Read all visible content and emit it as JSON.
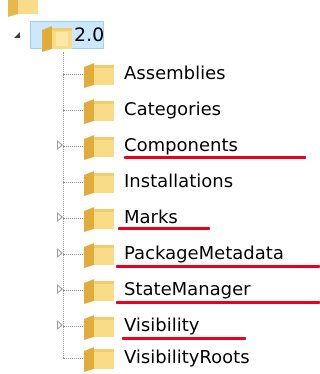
{
  "colors": {
    "selection_fill": "#cce8ff",
    "selection_border": "#99d1ff",
    "annotation_underline": "#e8001c",
    "folder_light": "#f8dc88",
    "folder_dark": "#d9a73c"
  },
  "tree": {
    "root": {
      "label": "2.0",
      "expanded": true,
      "selected": true,
      "icon": "folder-icon"
    },
    "children": [
      {
        "label": "Assemblies",
        "expandable": false,
        "underlined": false,
        "icon": "folder-icon"
      },
      {
        "label": "Categories",
        "expandable": false,
        "underlined": false,
        "icon": "folder-icon"
      },
      {
        "label": "Components",
        "expandable": true,
        "underlined": true,
        "icon": "folder-icon"
      },
      {
        "label": "Installations",
        "expandable": false,
        "underlined": false,
        "icon": "folder-icon"
      },
      {
        "label": "Marks",
        "expandable": true,
        "underlined": true,
        "icon": "folder-icon"
      },
      {
        "label": "PackageMetadata",
        "expandable": true,
        "underlined": true,
        "icon": "folder-icon"
      },
      {
        "label": "StateManager",
        "expandable": true,
        "underlined": true,
        "icon": "folder-icon"
      },
      {
        "label": "Visibility",
        "expandable": true,
        "underlined": true,
        "icon": "folder-icon"
      },
      {
        "label": "VisibilityRoots",
        "expandable": false,
        "underlined": false,
        "icon": "folder-icon"
      }
    ]
  }
}
